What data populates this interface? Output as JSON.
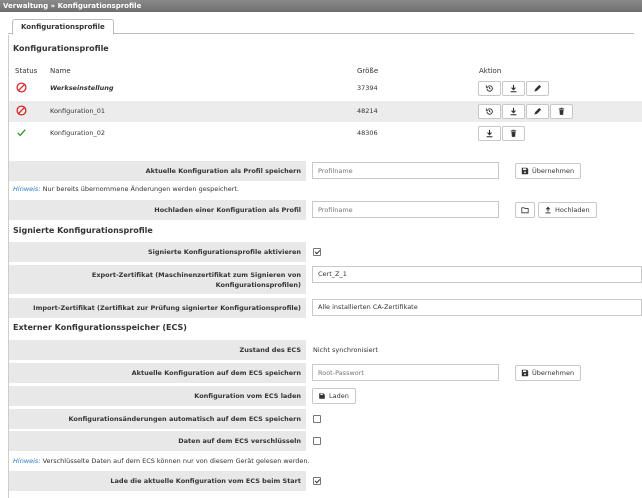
{
  "breadcrumb": {
    "part1": "Verwaltung",
    "sep": "»",
    "part2": "Konfigurationsprofile"
  },
  "tabs": [
    {
      "label": "Konfigurationsprofile",
      "active": true
    }
  ],
  "profiles": {
    "heading": "Konfigurationsprofile",
    "columns": {
      "status": "Status",
      "name": "Name",
      "size": "Größe",
      "action": "Aktion"
    },
    "rows": [
      {
        "status": "blocked",
        "name": "Werkseinstellung",
        "size": "37394",
        "actions": [
          "restore-icon",
          "download-icon",
          "edit-icon"
        ]
      },
      {
        "status": "blocked",
        "name": "Konfiguration_01",
        "size": "48214",
        "actions": [
          "restore-icon",
          "download-icon",
          "edit-icon",
          "delete-icon"
        ]
      },
      {
        "status": "active",
        "name": "Konfiguration_02",
        "size": "48306",
        "actions": [
          "download-icon",
          "delete-icon"
        ]
      }
    ]
  },
  "save_profile": {
    "label": "Aktuelle Konfiguration als Profil speichern",
    "placeholder": "Profilname",
    "button": "Übernehmen"
  },
  "hint1": {
    "key": "Hinweis:",
    "text": " Nur bereits übernommene Änderungen werden gespeichert."
  },
  "upload": {
    "label": "Hochladen einer Konfiguration als Profil",
    "placeholder": "Profilname",
    "button": "Hochladen"
  },
  "signed": {
    "heading": "Signierte Konfigurationsprofile",
    "enable_label": "Signierte Konfigurationsprofile aktivieren",
    "enable_checked": true,
    "export_label": "Export-Zertifikat (Maschinenzertifikat zum Signieren von Konfigurationsprofilen)",
    "export_value": "Cert_Z_1",
    "import_label": "Import-Zertifikat (Zertifikat zur Prüfung signierter Konfigurationsprofile)",
    "import_value": "Alle installierten CA-Zertifikate"
  },
  "ecs": {
    "heading": "Externer Konfigurationsspeicher (ECS)",
    "state_label": "Zustand des ECS",
    "state_value": "Nicht synchronisiert",
    "save_label": "Aktuelle Konfiguration auf dem ECS speichern",
    "save_placeholder": "Root-Passwort",
    "save_button": "Übernehmen",
    "load_label": "Konfiguration vom ECS laden",
    "load_button": "Laden",
    "auto_label": "Konfigurationsänderungen automatisch auf dem ECS speichern",
    "auto_checked": false,
    "encrypt_label": "Daten auf dem ECS verschlüsseln",
    "encrypt_checked": false,
    "hint_key": "Hinweis:",
    "hint_text": " Verschlüsselte Daten auf dem ECS können nur von diesem Gerät gelesen werden.",
    "startup_label": "Lade die aktuelle Konfiguration vom ECS beim Start",
    "startup_checked": true
  },
  "colors": {
    "blocked": "#d9262b",
    "active": "#3a9a3a",
    "hint_key": "#2a7ab8",
    "label_bg": "#e8e8e8",
    "titlebar": "#7a7a7a"
  }
}
